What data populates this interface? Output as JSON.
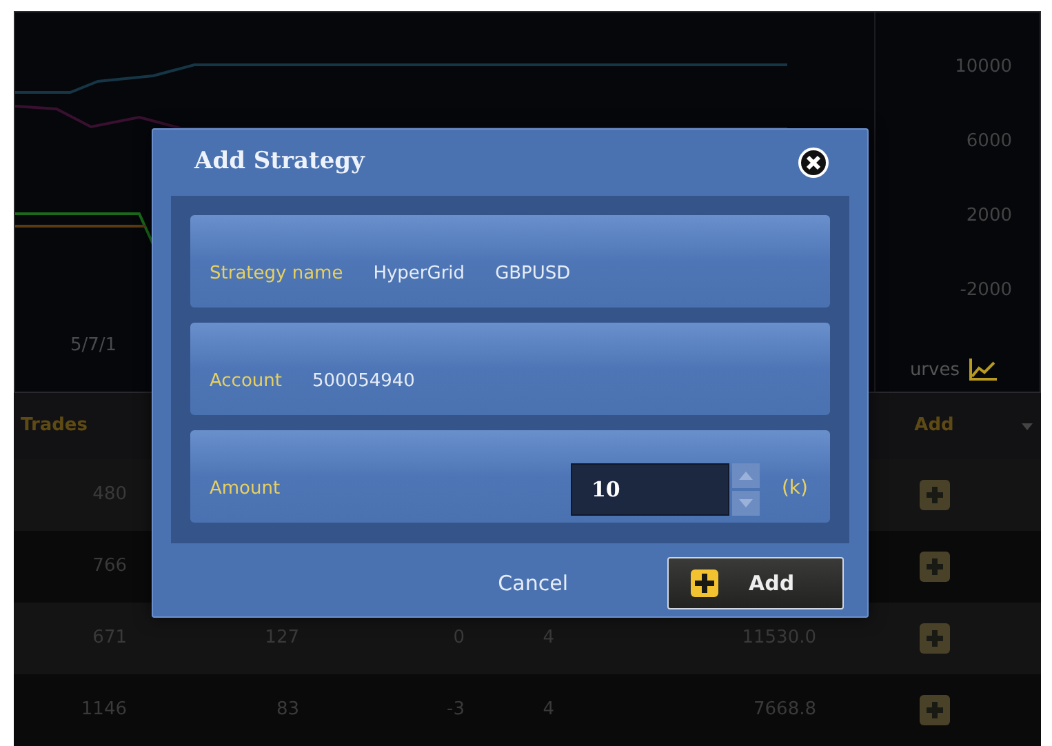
{
  "chart": {
    "date_label": "5/7/1",
    "axis_labels": [
      "10000",
      "6000",
      "2000",
      "-2000"
    ],
    "curves_label": "urves"
  },
  "table": {
    "columns": [
      "Trades",
      "Add"
    ],
    "rows": [
      {
        "cells": [
          "480"
        ]
      },
      {
        "cells": [
          "766"
        ]
      },
      {
        "cells": [
          "671",
          "127",
          "0",
          "4",
          "11530.0"
        ]
      },
      {
        "cells": [
          "1146",
          "83",
          "-3",
          "4",
          "7668.8"
        ]
      }
    ]
  },
  "dialog": {
    "title": "Add Strategy",
    "fields": [
      {
        "kind": "text",
        "label": "Strategy name",
        "values": [
          "HyperGrid",
          "GBPUSD"
        ]
      },
      {
        "kind": "text",
        "label": "Account",
        "values": [
          "500054940"
        ]
      },
      {
        "kind": "number",
        "label": "Amount",
        "value": "10",
        "unit": "(k)"
      }
    ],
    "buttons": [
      {
        "kind": "link",
        "label": "Cancel"
      },
      {
        "kind": "primary",
        "label": "Add"
      }
    ]
  }
}
